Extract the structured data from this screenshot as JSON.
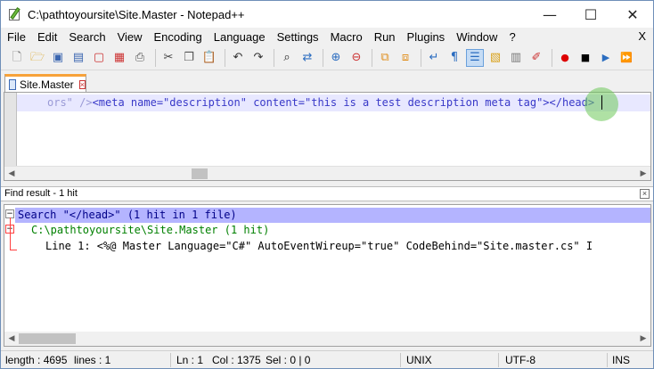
{
  "window": {
    "title": "C:\\pathtoyoursite\\Site.Master - Notepad++"
  },
  "window_controls": {
    "minimize": "—",
    "maximize": "☐",
    "close": "✕"
  },
  "menu": {
    "items": [
      "File",
      "Edit",
      "Search",
      "View",
      "Encoding",
      "Language",
      "Settings",
      "Macro",
      "Run",
      "Plugins",
      "Window",
      "?"
    ],
    "close_label": "X"
  },
  "toolbar": {
    "icons": [
      "new-icon",
      "open-icon",
      "save-icon",
      "save-all-icon",
      "close-icon",
      "close-all-icon",
      "print-icon",
      "cut-icon",
      "copy-icon",
      "paste-icon",
      "undo-icon",
      "redo-icon",
      "find-icon",
      "replace-icon",
      "zoom-in-icon",
      "zoom-out-icon",
      "sync-v-icon",
      "sync-h-icon",
      "word-wrap-icon",
      "show-all-icon",
      "indent-guide-icon",
      "doc-map-icon",
      "function-list-icon",
      "folder-icon",
      "record-icon",
      "stop-icon",
      "play-icon",
      "run-multiple-icon"
    ]
  },
  "tab": {
    "label": "Site.Master",
    "accent": "#f7a23a"
  },
  "editor": {
    "line_text_prefix": "ors\" />",
    "line_text": "<meta name=\"description\" content=\"this is a test description meta tag\">",
    "line_text_suffix": "</head>"
  },
  "find": {
    "header": "Find result - 1 hit",
    "search_line": "Search \"</head>\" (1 hit in 1 file)",
    "file_line": "C:\\pathtoyoursite\\Site.Master (1 hit)",
    "result_line": "Line 1: <%@ Master Language=\"C#\" AutoEventWireup=\"true\" CodeBehind=\"Site.master.cs\" I"
  },
  "status": {
    "length": "length : 4695",
    "lines": "lines : 1",
    "ln": "Ln : 1",
    "col": "Col : 1375",
    "sel": "Sel : 0 | 0",
    "eol": "UNIX",
    "encoding": "UTF-8",
    "mode": "INS"
  }
}
